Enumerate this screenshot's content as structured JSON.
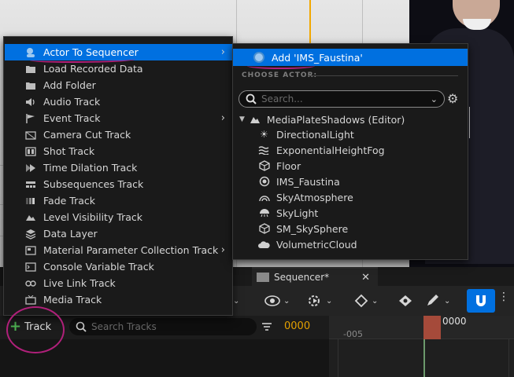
{
  "menu": {
    "items": [
      {
        "label": "Actor To Sequencer",
        "icon": "actor-icon",
        "has_submenu": true,
        "active": true
      },
      {
        "label": "Load Recorded Data",
        "icon": "folder-open-icon"
      },
      {
        "label": "Add Folder",
        "icon": "folder-icon"
      },
      {
        "label": "Audio Track",
        "icon": "speaker-icon"
      },
      {
        "label": "Event Track",
        "icon": "flag-icon",
        "has_submenu": true
      },
      {
        "label": "Camera Cut Track",
        "icon": "camera-icon"
      },
      {
        "label": "Shot Track",
        "icon": "film-icon"
      },
      {
        "label": "Time Dilation Track",
        "icon": "time-dilation-icon"
      },
      {
        "label": "Subsequences Track",
        "icon": "subsequence-icon"
      },
      {
        "label": "Fade Track",
        "icon": "fade-icon"
      },
      {
        "label": "Level Visibility Track",
        "icon": "level-icon"
      },
      {
        "label": "Data Layer",
        "icon": "layers-icon"
      },
      {
        "label": "Material Parameter Collection Track",
        "icon": "material-icon",
        "has_submenu": true
      },
      {
        "label": "Console Variable Track",
        "icon": "console-icon"
      },
      {
        "label": "Live Link Track",
        "icon": "live-link-icon"
      },
      {
        "label": "Media Track",
        "icon": "media-icon"
      }
    ]
  },
  "submenu": {
    "add_label": "Add 'IMS_Faustina'",
    "choose_header": "CHOOSE ACTOR:",
    "search_placeholder": "Search...",
    "tree_root": "MediaPlateShadows (Editor)",
    "actors": [
      {
        "label": "DirectionalLight",
        "icon": "sun-icon"
      },
      {
        "label": "ExponentialHeightFog",
        "icon": "fog-icon"
      },
      {
        "label": "Floor",
        "icon": "cube-icon"
      },
      {
        "label": "IMS_Faustina",
        "icon": "actor-icon"
      },
      {
        "label": "SkyAtmosphere",
        "icon": "sky-atmosphere-icon"
      },
      {
        "label": "SkyLight",
        "icon": "skylight-icon"
      },
      {
        "label": "SM_SkySphere",
        "icon": "cube-icon"
      },
      {
        "label": "VolumetricCloud",
        "icon": "cloud-icon"
      }
    ]
  },
  "sequencer": {
    "tab_label": "Sequencer*",
    "add_track_label": "Track",
    "search_placeholder": "Search Tracks",
    "current_frame": "0000",
    "playhead_label": "0000",
    "ruler_label": "-005"
  },
  "colors": {
    "accent": "#0070e0",
    "frame_readout": "#e3a000",
    "annotation": "#b0207a",
    "playhead": "#a54a3a"
  }
}
